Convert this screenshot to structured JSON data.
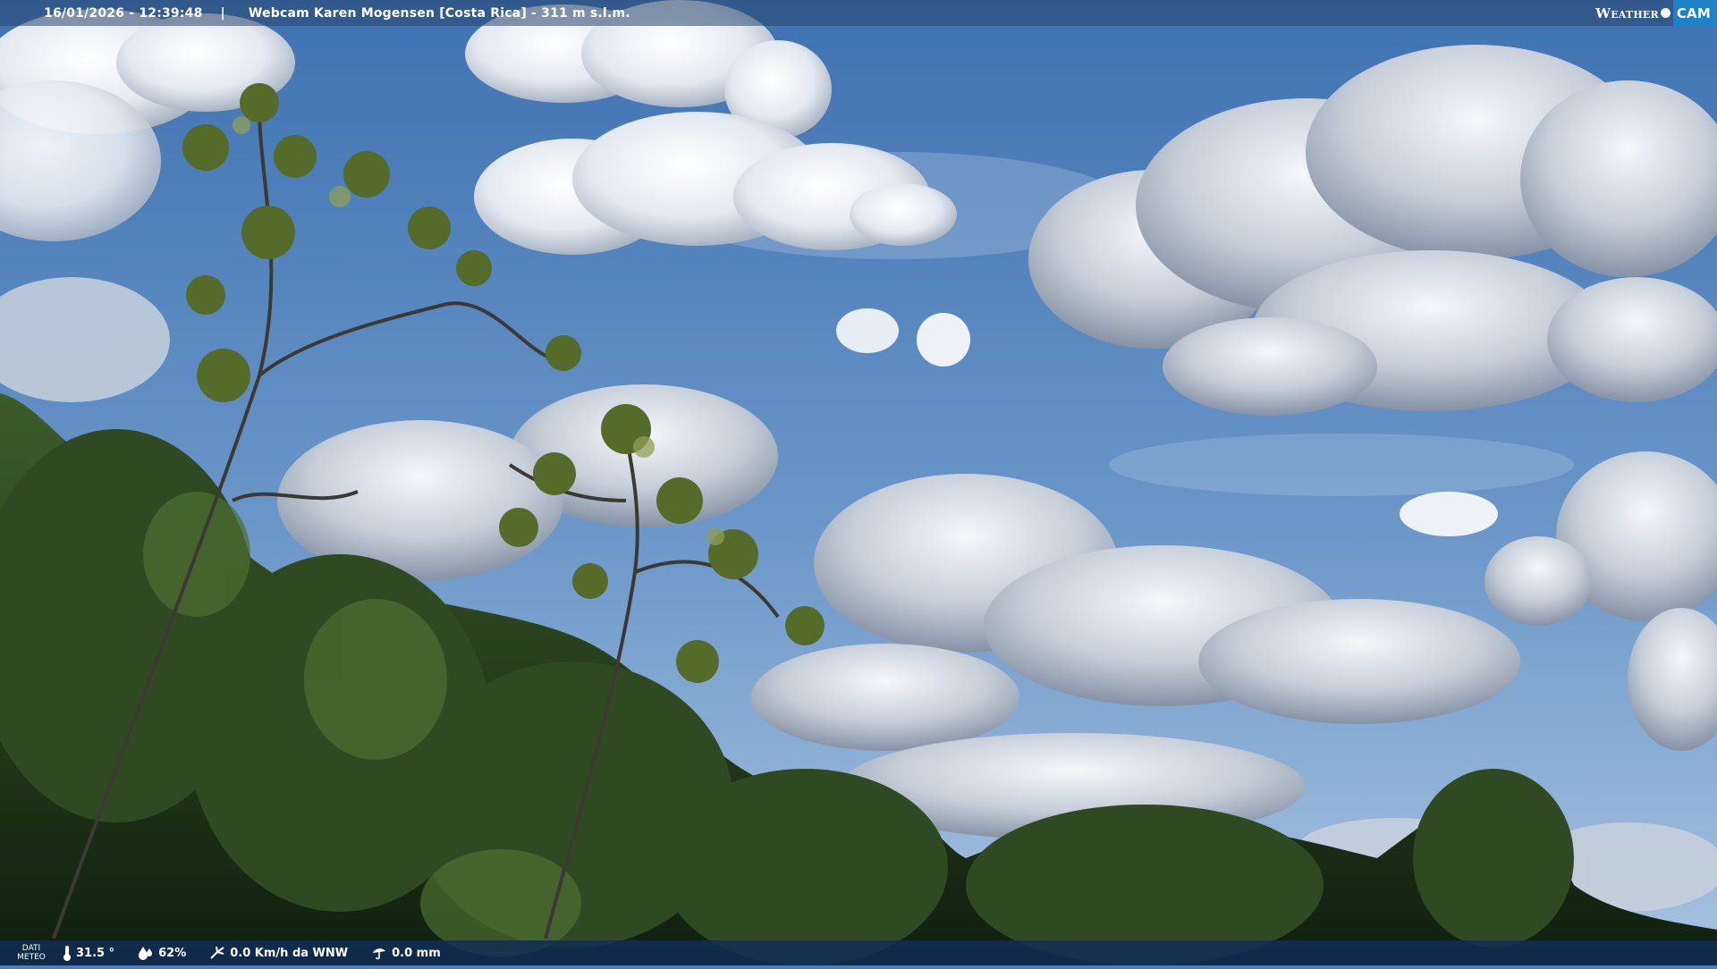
{
  "header": {
    "timestamp": "16/01/2026 - 12:39:48",
    "separator": "|",
    "title": "Webcam Karen Mogensen [Costa Rica] - 311 m s.l.m."
  },
  "brand": {
    "left": "Weather",
    "right": "CAM"
  },
  "footer": {
    "label_line1": "DATI",
    "label_line2": "METEO",
    "temperature": "31.5 °",
    "humidity": "62%",
    "wind": "0.0 Km/h da WNW",
    "rain": "0.0 mm"
  },
  "icons": [
    "thermometer-icon",
    "humidity-icon",
    "wind-icon",
    "rain-icon"
  ],
  "colors": {
    "sky": "#4f7fb8",
    "brand_accent": "#1d82c8",
    "footer_bg": "#122d55"
  }
}
